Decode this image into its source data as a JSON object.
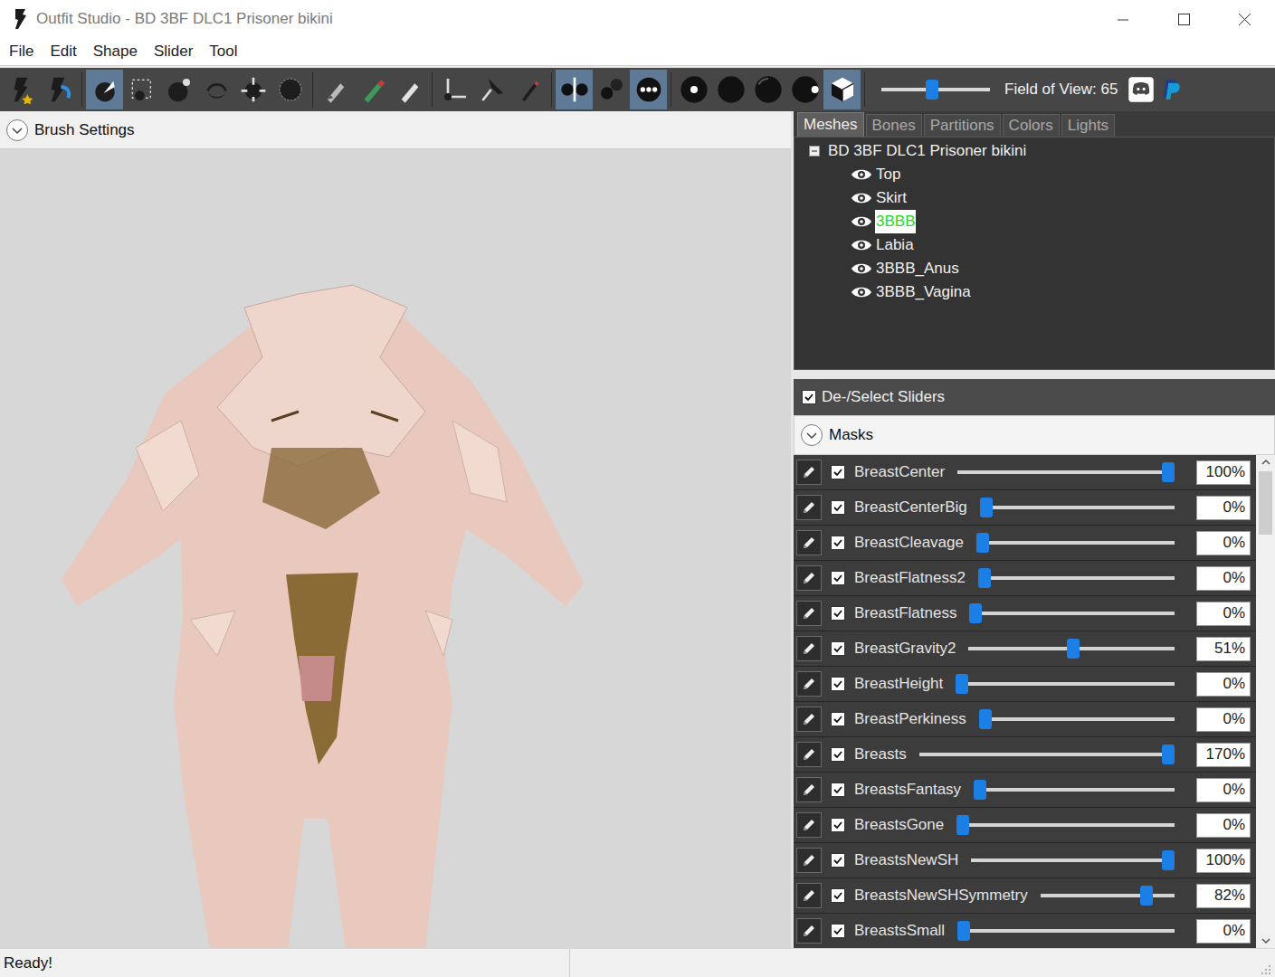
{
  "window": {
    "title": "Outfit Studio - BD 3BF DLC1 Prisoner bikini"
  },
  "menu": [
    "File",
    "Edit",
    "Shape",
    "Slider",
    "Tool"
  ],
  "toolbar": {
    "tool_groups": [
      [
        {
          "selected": false
        },
        {
          "selected": false
        }
      ],
      [
        {
          "selected": true
        },
        {
          "selected": false
        },
        {
          "selected": false
        },
        {
          "selected": false
        },
        {
          "selected": false
        },
        {
          "selected": false
        }
      ],
      [
        {
          "selected": false
        },
        {
          "selected": false
        },
        {
          "selected": false
        }
      ],
      [
        {
          "selected": false
        },
        {
          "selected": false
        },
        {
          "selected": false
        }
      ],
      [
        {
          "selected": true
        },
        {
          "selected": false
        },
        {
          "selected": true
        }
      ],
      [
        {
          "selected": false
        },
        {
          "selected": false
        },
        {
          "selected": false
        },
        {
          "selected": false
        },
        {
          "selected": true
        }
      ]
    ],
    "fov": {
      "label": "Field of View: 65",
      "level": 0.46
    }
  },
  "brush_settings": {
    "label": "Brush Settings"
  },
  "tabs": [
    {
      "label": "Meshes",
      "selected": true
    },
    {
      "label": "Bones",
      "selected": false
    },
    {
      "label": "Partitions",
      "selected": false
    },
    {
      "label": "Colors",
      "selected": false
    },
    {
      "label": "Lights",
      "selected": false
    }
  ],
  "tree": {
    "root": "BD 3BF DLC1 Prisoner bikini",
    "expanded": true,
    "items": [
      {
        "label": "Top",
        "visible": true,
        "selected": false
      },
      {
        "label": "Skirt",
        "visible": true,
        "selected": false
      },
      {
        "label": "3BBB",
        "visible": true,
        "selected": true
      },
      {
        "label": "Labia",
        "visible": true,
        "selected": false
      },
      {
        "label": "3BBB_Anus",
        "visible": true,
        "selected": false
      },
      {
        "label": "3BBB_Vagina",
        "visible": true,
        "selected": false
      }
    ]
  },
  "sliders_header": {
    "label": "De-/Select Sliders",
    "checked": true
  },
  "masks": {
    "label": "Masks"
  },
  "sliders": [
    {
      "name": "BreastCenter",
      "checked": true,
      "level": 1,
      "reading": "100%"
    },
    {
      "name": "BreastCenterBig",
      "checked": true,
      "level": 0,
      "reading": "0%"
    },
    {
      "name": "BreastCleavage",
      "checked": true,
      "level": 0,
      "reading": "0%"
    },
    {
      "name": "BreastFlatness2",
      "checked": true,
      "level": 0,
      "reading": "0%"
    },
    {
      "name": "BreastFlatness",
      "checked": true,
      "level": 0,
      "reading": "0%"
    },
    {
      "name": "BreastGravity2",
      "checked": true,
      "level": 0.51,
      "reading": "51%"
    },
    {
      "name": "BreastHeight",
      "checked": true,
      "level": 0,
      "reading": "0%"
    },
    {
      "name": "BreastPerkiness",
      "checked": true,
      "level": 0,
      "reading": "0%"
    },
    {
      "name": "Breasts",
      "checked": true,
      "level": 1,
      "reading": "170%"
    },
    {
      "name": "BreastsFantasy",
      "checked": true,
      "level": 0,
      "reading": "0%"
    },
    {
      "name": "BreastsGone",
      "checked": true,
      "level": 0,
      "reading": "0%"
    },
    {
      "name": "BreastsNewSH",
      "checked": true,
      "level": 1,
      "reading": "100%"
    },
    {
      "name": "BreastsNewSHSymmetry",
      "checked": true,
      "level": 0.82,
      "reading": "82%"
    },
    {
      "name": "BreastsSmall",
      "checked": true,
      "level": 0,
      "reading": "0%"
    }
  ],
  "status_bar": [
    "Ready!"
  ]
}
